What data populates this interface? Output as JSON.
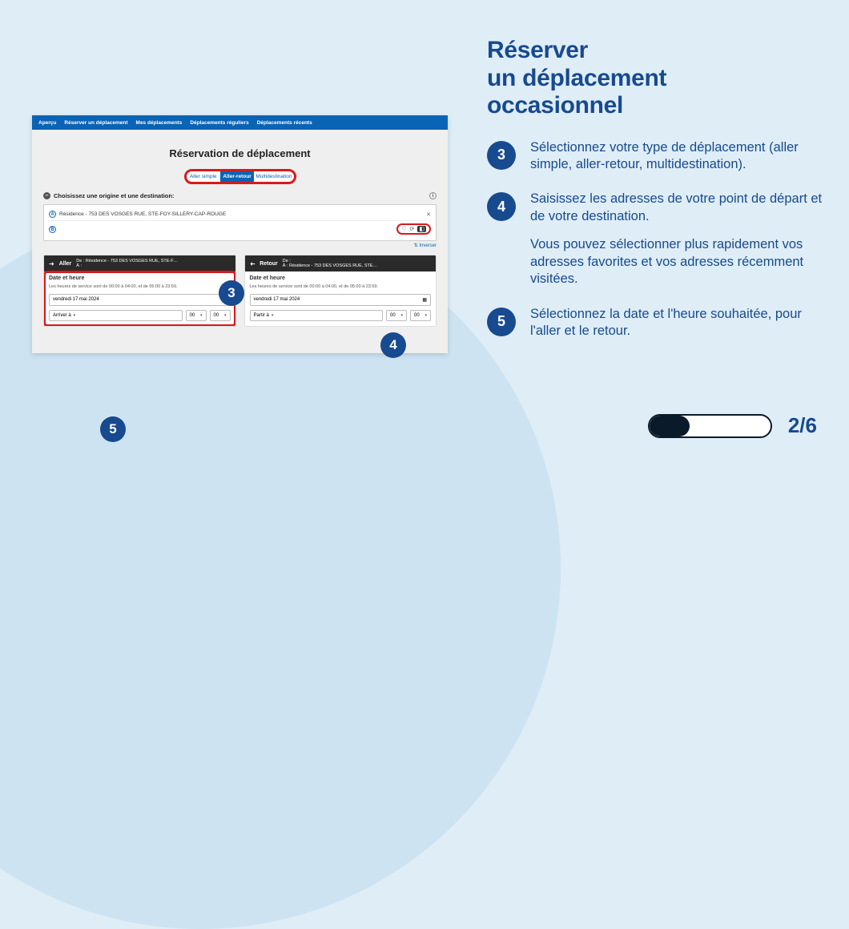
{
  "heading_l1": "Réserver",
  "heading_l2": "un déplacement",
  "heading_l3": "occasionnel",
  "steps": {
    "s3": {
      "num": "3",
      "text": "Sélectionnez votre type de déplacement (aller simple, aller-retour, multidestination)."
    },
    "s4": {
      "num": "4",
      "text": "Saisissez les adresses de votre point de départ et de votre destination.",
      "extra": "Vous pouvez sélectionner plus rapidement vos adresses favorites et vos adresses récemment visitées."
    },
    "s5": {
      "num": "5",
      "text": "Sélectionnez la date et l'heure souhaitée, pour l'aller et le retour."
    }
  },
  "shot": {
    "nav": {
      "apercu": "Aperçu",
      "reserver": "Réserver un déplacement",
      "mes": "Mes déplacements",
      "reguliers": "Déplacements réguliers",
      "recents": "Déplacements récents"
    },
    "title": "Réservation de déplacement",
    "trip_types": {
      "simple": "Aller simple",
      "retour": "Aller-retour",
      "multi": "Multidestination"
    },
    "origin_label": "Choisissez une origine et une destination:",
    "addr_a_badge": "A",
    "addr_a": "Résidence - 753 DES VOSGES RUE, STE-FOY-SILLERY-CAP-ROUGE",
    "addr_b_badge": "B",
    "invert": "⇅ Inverser",
    "legs": {
      "aller": {
        "label": "Aller",
        "de": "De :",
        "a": "À :",
        "residence": "Résidence - 753 DES VOSGES RUE, STE-F…",
        "dh": "Date et heure",
        "hours": "Les heures de service sont de 00:00 à 04:00, et de 05:00 à 23:59.",
        "date": "vendredi 17 mai 2024",
        "mode": "Arriver à",
        "hh": "00",
        "mm": "00"
      },
      "retour": {
        "label": "Retour",
        "de": "De :",
        "a": "À :",
        "residence": "Résidence - 753 DES VOSGES RUE, STE…",
        "dh": "Date et heure",
        "hours": "Les heures de service sont de 00:00 à 04:00, et de 05:00 à 23:59.",
        "date": "vendredi 17 mai 2024",
        "mode": "Partir à",
        "hh": "00",
        "mm": "00"
      }
    }
  },
  "page_indicator": "2/6",
  "progress_fill_pct": 33
}
